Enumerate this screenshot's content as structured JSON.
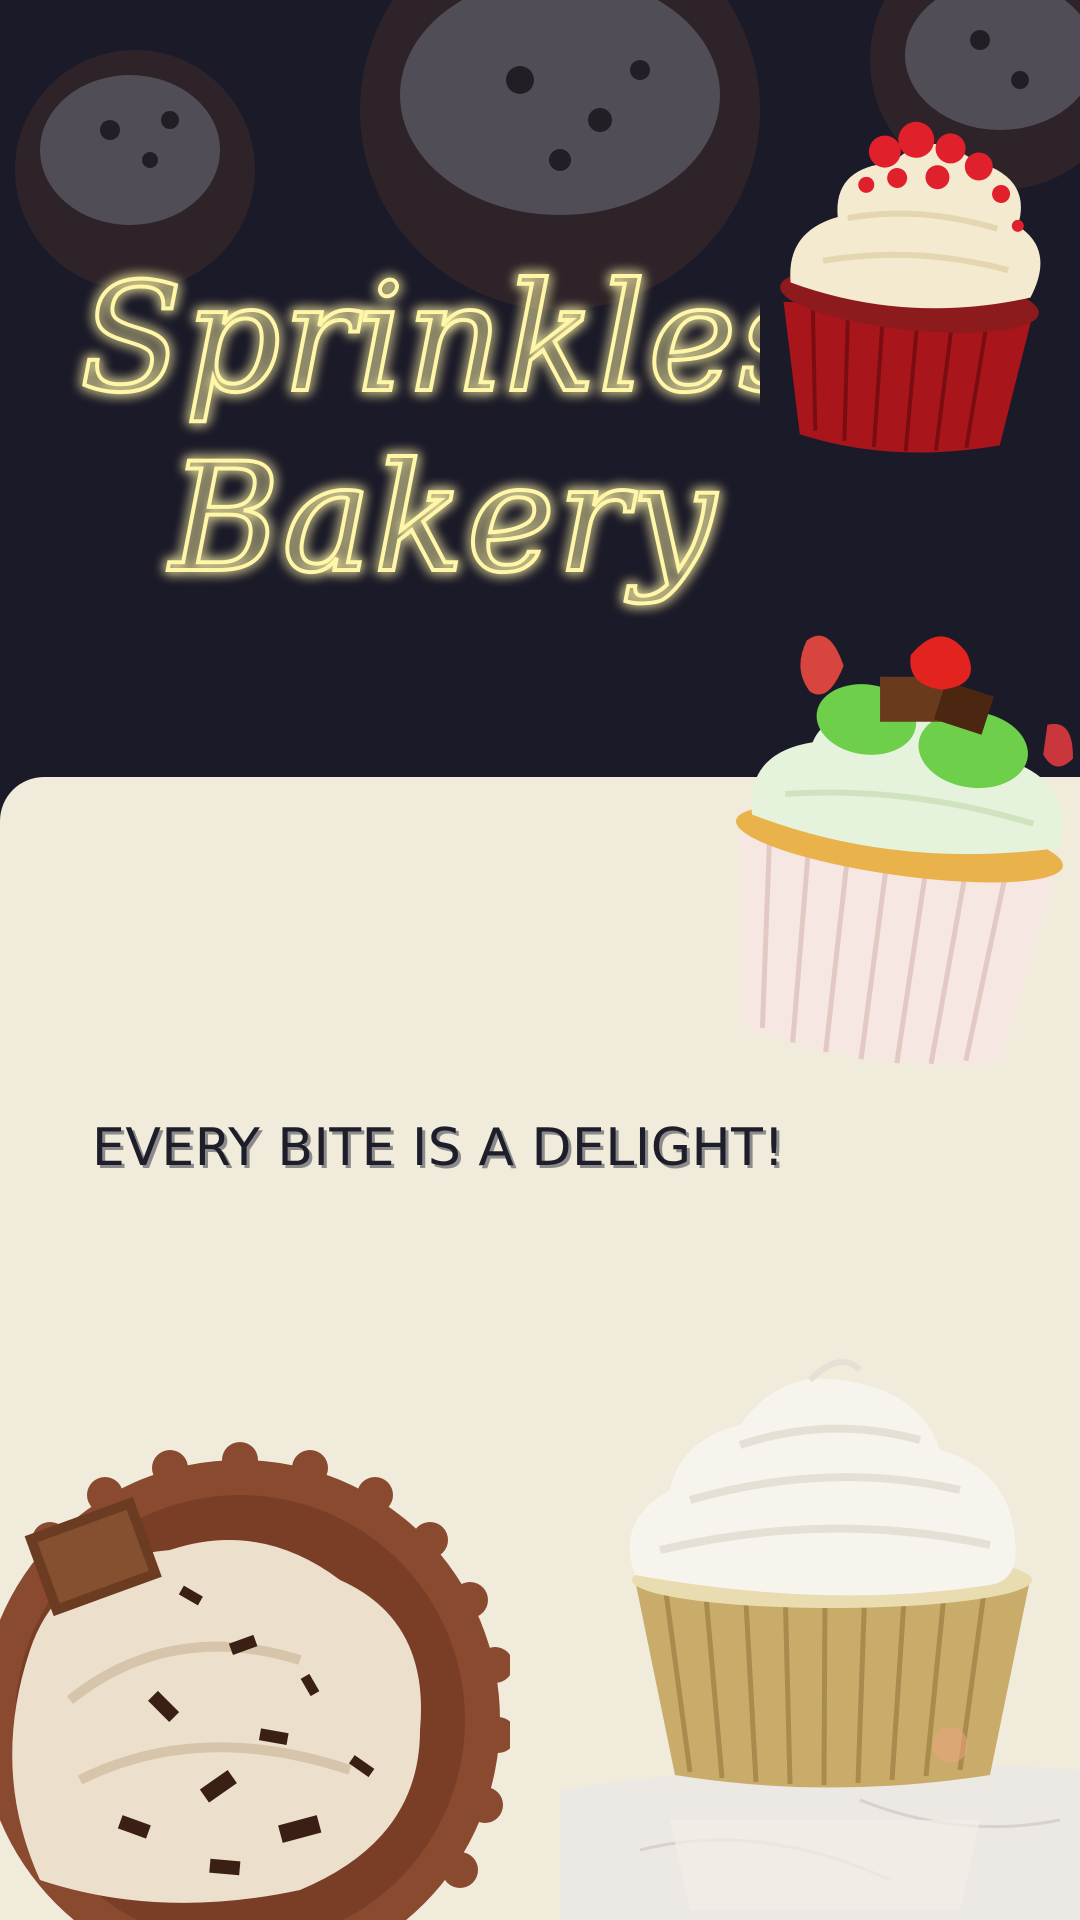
{
  "brand": {
    "name_line1": "Sprinkles",
    "name_line2": "Bakery"
  },
  "tagline": "EVERY BITE IS A DELIGHT!",
  "colors": {
    "hero_bg": "#1b1a28",
    "panel_bg": "#f0ebda",
    "neon": "#fff6a8",
    "text_dark": "#1e1d2a"
  },
  "images": {
    "hero_background": "faded chocolate cupcakes",
    "red_velvet": "red velvet cupcake with cream frosting and crumbs",
    "strawberry_mint": "vanilla cupcake with strawberry, chocolate and mint",
    "chocolate_top": "chocolate cupcake top view with chocolate shavings",
    "vanilla_gold": "vanilla cupcake in gold foil liner on marble"
  }
}
